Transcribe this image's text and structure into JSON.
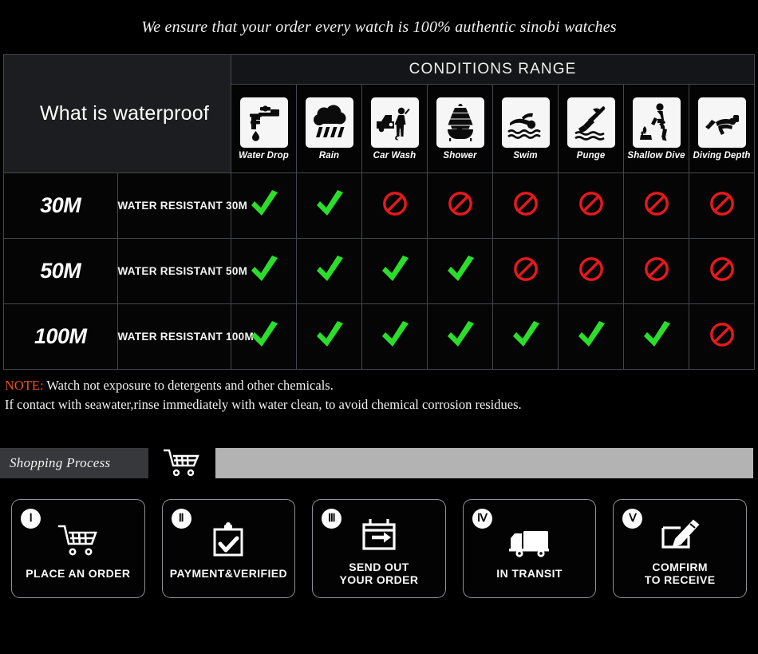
{
  "banner": {
    "text": "We ensure that your order every watch is 100% authentic sinobi watches"
  },
  "table": {
    "title": "What is waterproof",
    "conditions_header": "CONDITIONS RANGE",
    "columns": [
      {
        "label": "Water Drop",
        "icon": "faucet-drop-icon"
      },
      {
        "label": "Rain",
        "icon": "rain-cloud-icon"
      },
      {
        "label": "Car Wash",
        "icon": "car-wash-icon"
      },
      {
        "label": "Shower",
        "icon": "shower-bath-icon"
      },
      {
        "label": "Swim",
        "icon": "swimmer-icon"
      },
      {
        "label": "Punge",
        "icon": "plunge-dive-icon"
      },
      {
        "label": "Shallow Dive",
        "icon": "shallow-dive-icon"
      },
      {
        "label": "Diving Depth",
        "icon": "scuba-diver-icon"
      }
    ],
    "rows": [
      {
        "depth": "30M",
        "description": "WATER RESISTANT  30M",
        "marks": [
          "yes",
          "yes",
          "no",
          "no",
          "no",
          "no",
          "no",
          "no"
        ]
      },
      {
        "depth": "50M",
        "description": "WATER RESISTANT 50M",
        "marks": [
          "yes",
          "yes",
          "yes",
          "yes",
          "no",
          "no",
          "no",
          "no"
        ]
      },
      {
        "depth": "100M",
        "description": "WATER RESISTANT  100M",
        "marks": [
          "yes",
          "yes",
          "yes",
          "yes",
          "yes",
          "yes",
          "yes",
          "no"
        ]
      }
    ]
  },
  "note": {
    "keyword": "NOTE:",
    "line1": " Watch not exposure to detergents and other chemicals.",
    "line2": "If contact with seawater,rinse immediately with water clean, to avoid chemical corrosion residues."
  },
  "shopping_process": {
    "tag": "Shopping Process",
    "cart_icon": "shopping-cart-icon"
  },
  "steps": [
    {
      "numeral": "Ⅰ",
      "label": "PLACE AN ORDER",
      "icon": "shopping-cart-icon"
    },
    {
      "numeral": "Ⅱ",
      "label": "PAYMENT&VERIFIED",
      "icon": "clipboard-check-icon"
    },
    {
      "numeral": "Ⅲ",
      "label": "SEND OUT\nYOUR ORDER",
      "icon": "calendar-arrow-icon"
    },
    {
      "numeral": "Ⅳ",
      "label": "IN TRANSIT",
      "icon": "delivery-truck-icon"
    },
    {
      "numeral": "Ⅴ",
      "label": "COMFIRM\nTO RECEIVE",
      "icon": "edit-pencil-icon"
    }
  ],
  "colors": {
    "background": "#000000",
    "check_green": "#2BDE2B",
    "deny_red": "#E8181C",
    "note_keyword": "#E4551C",
    "icon_box": "#F6F6F6",
    "grid_line": "#44474B",
    "process_bar": "#B3B3B3",
    "tag_background": "#36383B"
  }
}
